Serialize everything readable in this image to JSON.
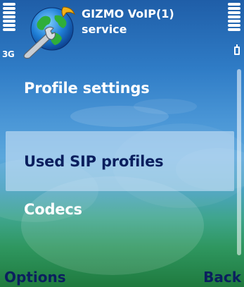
{
  "status": {
    "network": "3G",
    "signal_bars": 5,
    "battery_bars": 7
  },
  "header": {
    "app_title": "GIZMO VoIP(1)",
    "subtitle": "service",
    "icon": "globe-wrench-icon"
  },
  "menu": {
    "items": [
      {
        "label": "Profile settings"
      },
      {
        "label": "Used SIP profiles",
        "selected": true
      },
      {
        "label": "Codecs"
      }
    ]
  },
  "softkeys": {
    "left": "Options",
    "right": "Back"
  },
  "colors": {
    "highlight_text": "#0b1f5e",
    "text": "#ffffff",
    "selected_bg": "#c8e1f5"
  }
}
